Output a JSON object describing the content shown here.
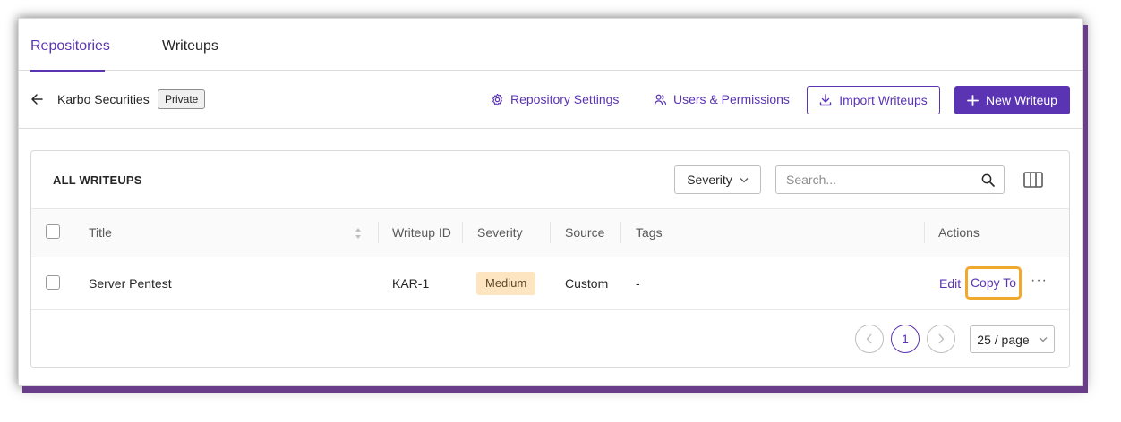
{
  "tabs": [
    {
      "label": "Repositories",
      "active": true
    },
    {
      "label": "Writeups",
      "active": false
    }
  ],
  "header": {
    "repo_name": "Karbo Securities",
    "visibility_badge": "Private",
    "repo_settings_label": "Repository Settings",
    "users_permissions_label": "Users & Permissions",
    "import_label": "Import Writeups",
    "new_writeup_label": "New Writeup"
  },
  "table_card": {
    "title": "ALL WRITEUPS",
    "severity_filter_label": "Severity",
    "search_placeholder": "Search...",
    "columns": [
      "Title",
      "Writeup ID",
      "Severity",
      "Source",
      "Tags",
      "Actions"
    ],
    "rows": [
      {
        "title": "Server Pentest",
        "writeup_id": "KAR-1",
        "severity": "Medium",
        "source": "Custom",
        "tags": "-",
        "actions": {
          "edit": "Edit",
          "copy_to": "Copy To",
          "more": "···"
        }
      }
    ]
  },
  "pagination": {
    "current_page": "1",
    "page_size_label": "25 / page"
  },
  "colors": {
    "accent": "#5b34b4",
    "severity_medium_bg": "#fde5c2",
    "highlight": "#f0a92c"
  },
  "icons": [
    "back-arrow-icon",
    "gear-icon",
    "users-icon",
    "download-icon",
    "plus-icon",
    "chevron-down-icon",
    "search-icon",
    "columns-icon",
    "sort-icon",
    "chevron-left-icon",
    "chevron-right-icon"
  ]
}
